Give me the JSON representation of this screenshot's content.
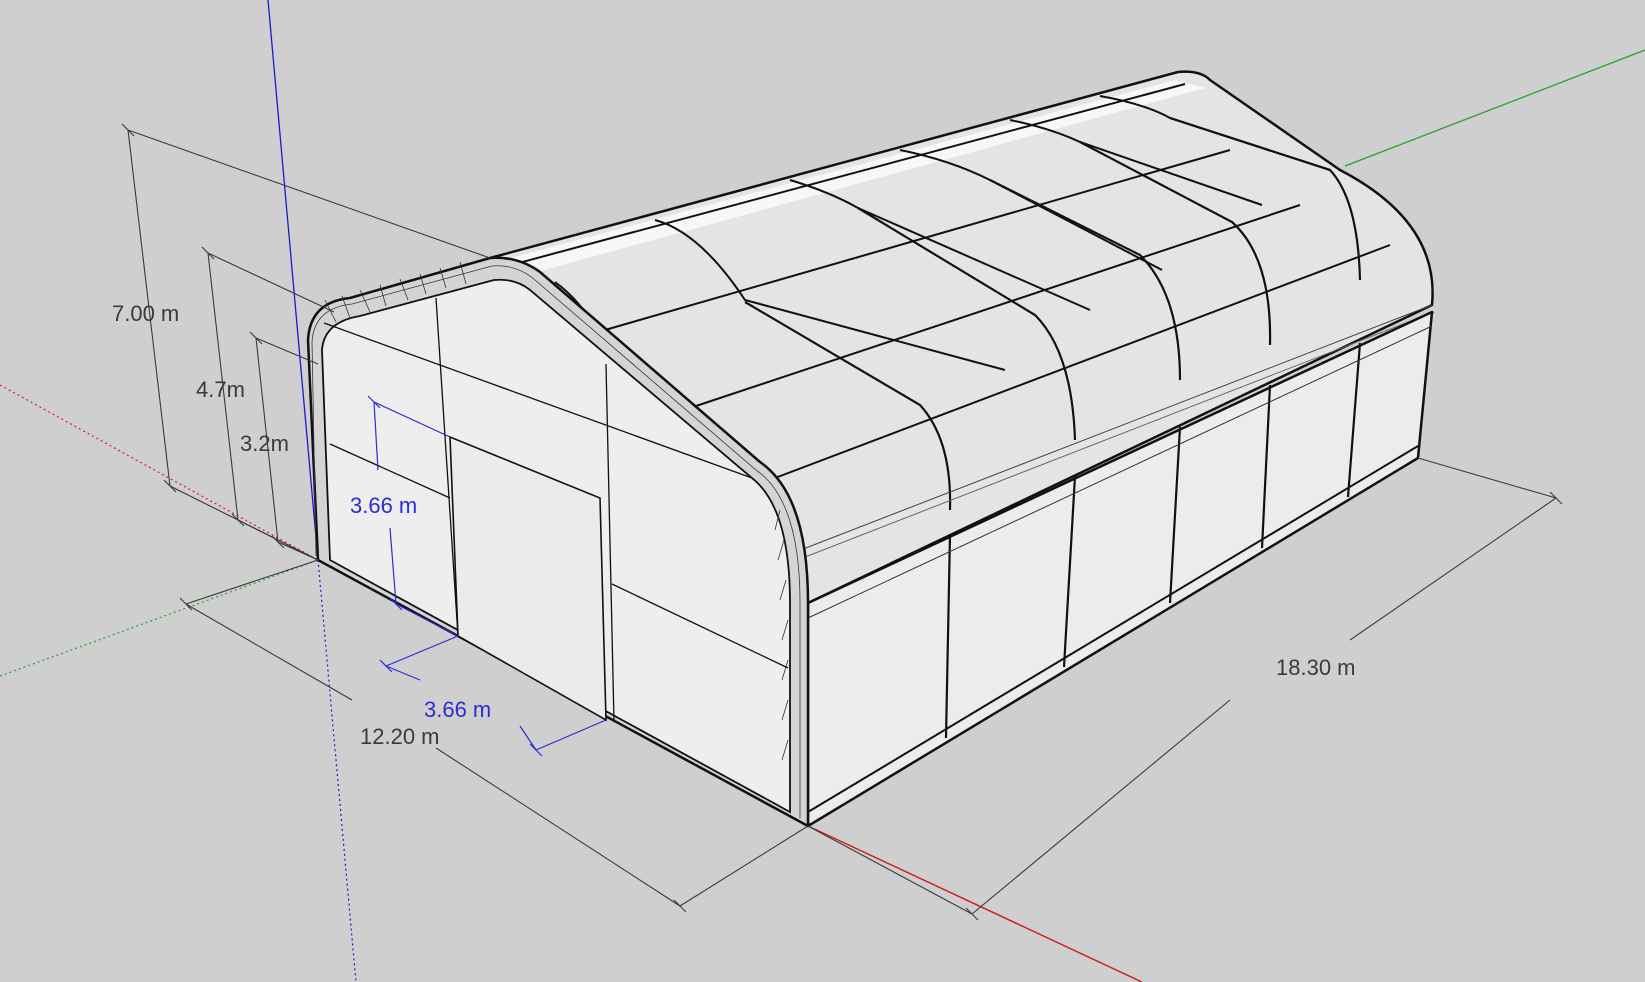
{
  "colors": {
    "background": "#cfcfcf",
    "axis_red": "#d02020",
    "axis_green": "#2ea02e",
    "axis_blue": "#1a1ad0",
    "dimension_black": "#3a3a3a",
    "dimension_blue": "#2c2cd6",
    "panel_fill": "#e6e6e6",
    "wall_fill": "#ececec",
    "outline": "#111111"
  },
  "dimensions": {
    "overall_height": "7.00 m",
    "sidewall_height": "4.7m",
    "eave_height": "3.2m",
    "door_height": "3.66 m",
    "door_width": "3.66 m",
    "building_width": "12.20 m",
    "building_length": "18.30 m"
  }
}
